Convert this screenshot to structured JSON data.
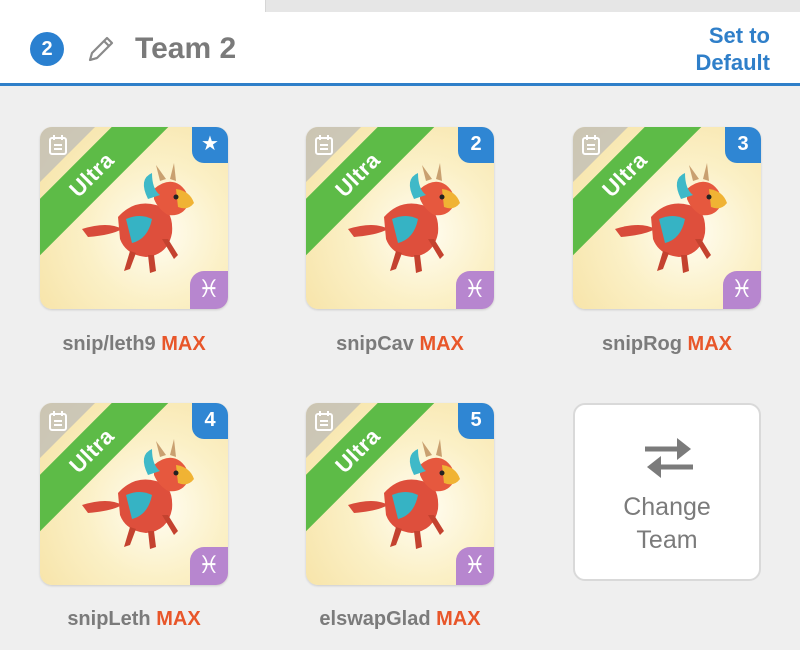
{
  "header": {
    "team_number": "2",
    "team_name": "Team 2",
    "set_default_line1": "Set to",
    "set_default_line2": "Default"
  },
  "cards": [
    {
      "rarity": "Ultra",
      "badge": "★",
      "name": "snip/leth9",
      "level": "MAX"
    },
    {
      "rarity": "Ultra",
      "badge": "2",
      "name": "snipCav",
      "level": "MAX"
    },
    {
      "rarity": "Ultra",
      "badge": "3",
      "name": "snipRog",
      "level": "MAX"
    },
    {
      "rarity": "Ultra",
      "badge": "4",
      "name": "snipLeth",
      "level": "MAX"
    },
    {
      "rarity": "Ultra",
      "badge": "5",
      "name": "elswapGlad",
      "level": "MAX"
    }
  ],
  "change_team": {
    "line1": "Change",
    "line2": "Team"
  },
  "icons": {
    "element": "pisces-icon",
    "edit": "pencil-icon",
    "swap": "swap-arrows-icon",
    "info": "calendar-icon"
  },
  "colors": {
    "accent_blue": "#2f7fc9",
    "ultra_green": "#5dbb47",
    "max_orange": "#e8562a",
    "element_purple": "#b786cf"
  }
}
